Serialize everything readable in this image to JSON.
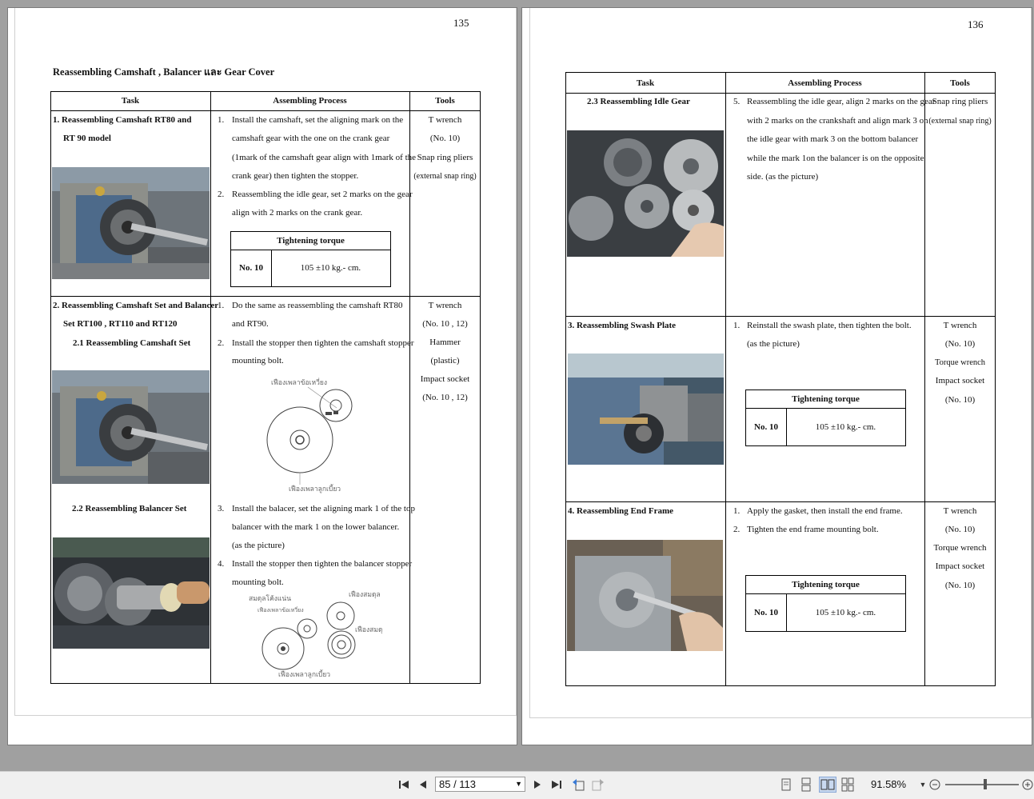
{
  "viewer": {
    "page_indicator": "85 / 113",
    "zoom": "91.58%",
    "zoom_slider_level": 0.55
  },
  "left_page": {
    "number": "135",
    "title": "Reassembling Camshaft , Balancer  และ Gear Cover",
    "headers": {
      "task": "Task",
      "process": "Assembling Process",
      "tools": "Tools"
    },
    "row1": {
      "task_line1": "1. Reassembling Camshaft RT80 and",
      "task_line2": "RT 90 model",
      "steps": [
        {
          "num": "1.",
          "lines": [
            "Install the camshaft, set the aligning mark on the",
            "camshaft gear with the one on the crank gear",
            "(1mark of the camshaft gear align with 1mark of the",
            "crank gear) then tighten the stopper."
          ]
        },
        {
          "num": "2.",
          "lines": [
            "Reassembling the idle gear, set 2 marks on the gear",
            "align with 2 marks on the crank gear."
          ]
        }
      ],
      "torque": {
        "header": "Tightening torque",
        "no": "No. 10",
        "value": "105  ±10  kg.- cm."
      },
      "tools": [
        "T wrench",
        "(No. 10)",
        "Snap ring pliers",
        "(external snap ring)"
      ]
    },
    "row2": {
      "task_line1": "2. Reassembling Camshaft Set and Balancer",
      "task_line2": "Set  RT100 , RT110 and RT120",
      "sub1": "2.1 Reassembling Camshaft Set",
      "sub2": "2.2  Reassembling Balancer Set",
      "steps_a": [
        {
          "num": "1.",
          "lines": [
            "Do the same as reassembling the camshaft RT80",
            "and RT90."
          ]
        },
        {
          "num": "2.",
          "lines": [
            "Install the stopper then tighten the camshaft stopper",
            "mounting bolt."
          ]
        }
      ],
      "diagram1_labels": {
        "top": "เฟืองเพลาข้อเหวี่ยง",
        "bottom": "เฟืองเพลาลูกเบี้ยว"
      },
      "steps_b": [
        {
          "num": "3.",
          "lines": [
            "Install the balacer, set the aligning mark 1 of the top",
            "balancer with the mark 1 on the lower balancer.",
            "(as the picture)"
          ]
        },
        {
          "num": "4.",
          "lines": [
            "Install the stopper then tighten the balancer stopper",
            "mounting bolt."
          ]
        }
      ],
      "diagram2_labels": {
        "a": "สมดุลโค้งแน่น",
        "b": "เฟืองเพลาข้อเหวี่ยง",
        "c": "เฟืองสมดุล",
        "d": "เฟืองสมดุล",
        "e": "เฟืองเพลาลูกเบี้ยว"
      },
      "tools": [
        "T wrench",
        "(No. 10 , 12)",
        "Hammer",
        "(plastic)",
        "Impact socket",
        "(No. 10 , 12)"
      ]
    }
  },
  "right_page": {
    "number": "136",
    "headers": {
      "task": "Task",
      "process": "Assembling Process",
      "tools": "Tools"
    },
    "row1": {
      "task": "2.3 Reassembling Idle Gear",
      "step_num": "5.",
      "lines": [
        "Reassembling the idle gear, align 2 marks on the gear",
        "with 2 marks on the crankshaft and align mark 3 on",
        "the idle gear with mark 3 on the bottom balancer",
        "while the mark 1on the balancer is on the opposite",
        "side. (as the picture)"
      ],
      "tools": [
        "Snap ring pliers",
        "(external snap ring)"
      ]
    },
    "row2": {
      "task": "3. Reassembling Swash Plate",
      "step_num": "1.",
      "lines": [
        "Reinstall the swash plate, then tighten the bolt.",
        "(as the picture)"
      ],
      "torque": {
        "header": "Tightening torque",
        "no": "No. 10",
        "value": "105  ±10  kg.- cm."
      },
      "tools": [
        "T wrench",
        "(No. 10)",
        "Torque wrench",
        "Impact socket",
        "(No. 10)"
      ]
    },
    "row3": {
      "task": "4. Reassembling End Frame",
      "steps": [
        {
          "num": "1.",
          "line": "Apply the gasket, then install the end frame."
        },
        {
          "num": "2.",
          "line": "Tighten the end frame mounting bolt."
        }
      ],
      "torque": {
        "header": "Tightening torque",
        "no": "No. 10",
        "value": "105   ±10  kg.- cm."
      },
      "tools": [
        "T wrench",
        "(No. 10)",
        "Torque wrench",
        "Impact socket",
        "(No. 10)"
      ]
    }
  }
}
